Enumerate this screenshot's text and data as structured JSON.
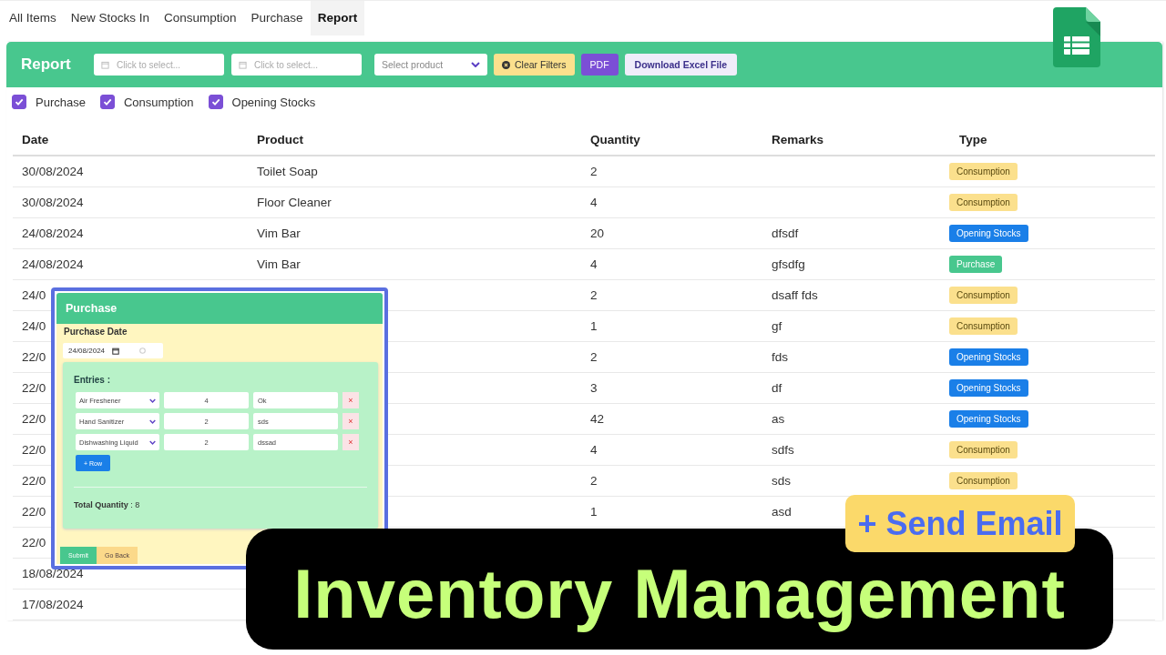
{
  "tabs": [
    {
      "label": "All Items",
      "selected": false
    },
    {
      "label": "New Stocks In",
      "selected": false
    },
    {
      "label": "Consumption",
      "selected": false
    },
    {
      "label": "Purchase",
      "selected": false
    },
    {
      "label": "Report",
      "selected": true
    }
  ],
  "report": {
    "title": "Report",
    "date_from": {
      "placeholder": "Click to select..."
    },
    "date_to": {
      "placeholder": "Click to select..."
    },
    "product": {
      "placeholder": "Select product"
    },
    "clear_button": "Clear Filters",
    "pdf_button": "PDF",
    "excel_button": "Download Excel File"
  },
  "filters": [
    {
      "label": "Purchase",
      "checked": true
    },
    {
      "label": "Consumption",
      "checked": true
    },
    {
      "label": "Opening Stocks",
      "checked": true
    }
  ],
  "table": {
    "columns": [
      "Date",
      "Product",
      "Quantity",
      "Remarks",
      "Type"
    ],
    "rows": [
      {
        "date": "30/08/2024",
        "product": "Toilet Soap",
        "quantity": "2",
        "type": {
          "label": "Consumption",
          "kind": "consumption"
        }
      },
      {
        "date": "30/08/2024",
        "product": "Floor Cleaner",
        "quantity": "4",
        "type": {
          "label": "Consumption",
          "kind": "consumption"
        }
      },
      {
        "date": "24/08/2024",
        "product": "Vim Bar",
        "quantity": "20",
        "remarks": "dfsdf",
        "type": {
          "label": "Opening Stocks",
          "kind": "opening"
        }
      },
      {
        "date": "24/08/2024",
        "product": "Vim Bar",
        "quantity": "4",
        "remarks": "gfsdfg",
        "type": {
          "label": "Purchase",
          "kind": "purchase"
        }
      },
      {
        "date": "24/0",
        "quantity": "2",
        "remarks": "dsaff fds",
        "type": {
          "label": "Consumption",
          "kind": "consumption"
        }
      },
      {
        "date": "24/0",
        "quantity": "1",
        "remarks": "gf",
        "type": {
          "label": "Consumption",
          "kind": "consumption"
        }
      },
      {
        "date": "22/0",
        "quantity": "2",
        "remarks": "fds",
        "type": {
          "label": "Opening Stocks",
          "kind": "opening"
        }
      },
      {
        "date": "22/0",
        "quantity": "3",
        "remarks": "df",
        "type": {
          "label": "Opening Stocks",
          "kind": "opening"
        }
      },
      {
        "date": "22/0",
        "quantity": "42",
        "remarks": "as",
        "type": {
          "label": "Opening Stocks",
          "kind": "opening"
        }
      },
      {
        "date": "22/0",
        "quantity": "4",
        "remarks": "sdfs",
        "type": {
          "label": "Consumption",
          "kind": "consumption"
        }
      },
      {
        "date": "22/0",
        "quantity": "2",
        "remarks": "sds",
        "type": {
          "label": "Consumption",
          "kind": "consumption"
        }
      },
      {
        "date": "22/0",
        "quantity": "1",
        "remarks": "asd"
      },
      {
        "date": "22/0"
      },
      {
        "date": "18/08/2024"
      },
      {
        "date": "17/08/2024"
      }
    ]
  },
  "modal": {
    "title": "Purchase",
    "date_label": "Purchase Date",
    "date_value": "24/08/2024",
    "entries_label": "Entries :",
    "entries": [
      {
        "product": "Air Freshener",
        "quantity": "4",
        "remark": "Ok",
        "remove": "×"
      },
      {
        "product": "Hand Sanitizer",
        "quantity": "2",
        "remark": "sds",
        "remove": "×"
      },
      {
        "product": "Dishwashing Liquid",
        "quantity": "2",
        "remark": "dssad",
        "remove": "×"
      }
    ],
    "add_row_button": "+ Row",
    "total": "**Total Quantity** : 8",
    "submit_button": "Submit",
    "back_button": "Go Back"
  },
  "banner": {
    "title": "Inventory Management",
    "badge": "+ Send Email"
  }
}
